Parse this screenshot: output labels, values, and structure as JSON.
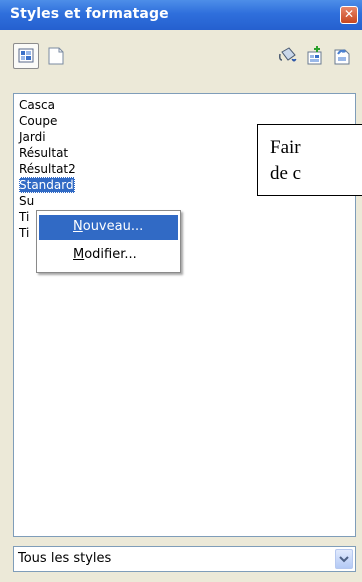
{
  "window": {
    "title": "Styles et formatage",
    "close_glyph": "✕"
  },
  "toolbar": {
    "buttons": [
      {
        "name": "paragraph-styles",
        "icon": "paragraph-styles-icon",
        "pressed": true
      },
      {
        "name": "page-styles",
        "icon": "page-styles-icon",
        "pressed": false
      },
      {
        "name": "fill-format-mode",
        "icon": "paint-bucket-icon",
        "pressed": false
      },
      {
        "name": "new-style-from-selection",
        "icon": "new-style-icon",
        "pressed": false
      },
      {
        "name": "update-style",
        "icon": "update-style-icon",
        "pressed": false
      }
    ]
  },
  "style_list": {
    "items": [
      "Casca",
      "Coupe",
      "Jardi",
      "Résultat",
      "Résultat2",
      "Standard",
      "Su",
      "Ti",
      "Ti"
    ],
    "selected": "Standard"
  },
  "tooltip": {
    "line1": "Fair",
    "line2": "de c"
  },
  "context_menu": {
    "items": [
      {
        "label": "Nouveau...",
        "mnemonic": "N",
        "rest": "ouveau...",
        "highlighted": true
      },
      {
        "label": "Modifier...",
        "mnemonic": "M",
        "rest": "odifier...",
        "highlighted": false
      }
    ]
  },
  "filter": {
    "selected": "Tous les styles"
  },
  "colors": {
    "titlebar": "#2f6fdc",
    "selection": "#316ac5",
    "panel": "#ece9d8"
  }
}
